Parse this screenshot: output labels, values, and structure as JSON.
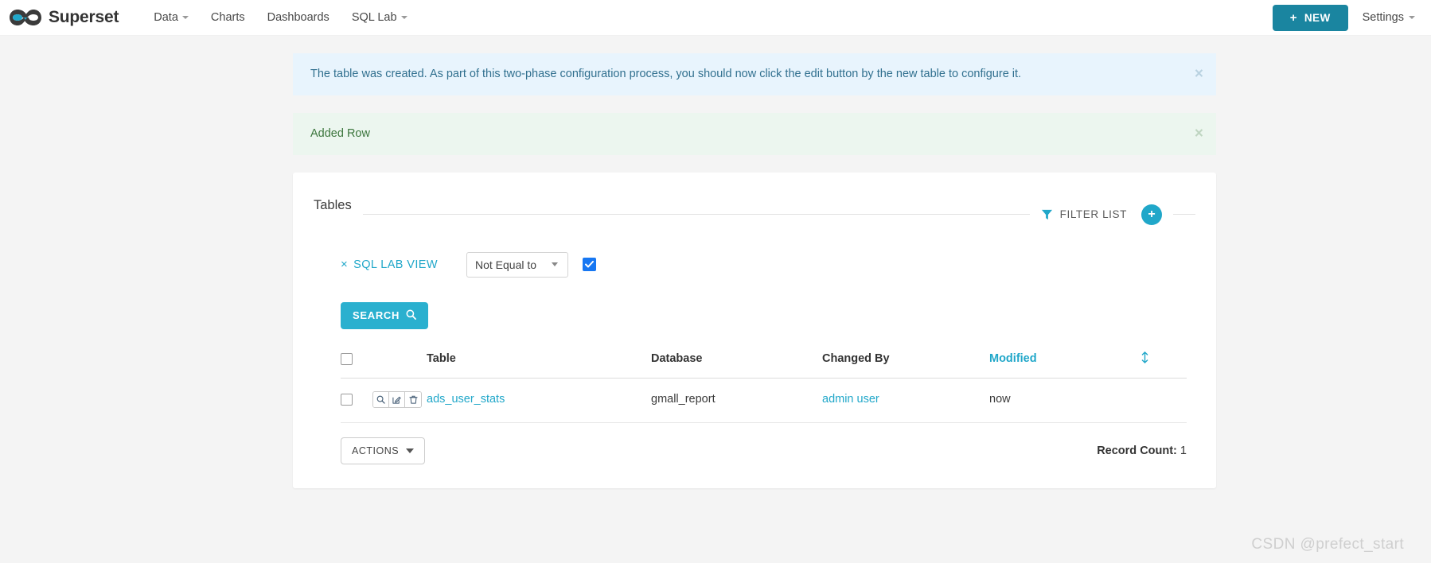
{
  "navbar": {
    "brand": "Superset",
    "brand_logo_icon": "superset-infinity-logo",
    "items": [
      {
        "label": "Data",
        "has_caret": true
      },
      {
        "label": "Charts",
        "has_caret": false
      },
      {
        "label": "Dashboards",
        "has_caret": false
      },
      {
        "label": "SQL Lab",
        "has_caret": true
      }
    ],
    "new_button": {
      "label": "NEW",
      "icon": "plus-icon",
      "color": "#1a85a0"
    },
    "settings": {
      "label": "Settings",
      "has_caret": true
    }
  },
  "alerts": [
    {
      "type": "info",
      "message": "The table was created. As part of this two-phase configuration process, you should now click the edit button by the new table to configure it.",
      "close_label": "×",
      "bg": "#e8f4fd",
      "fg": "#31708f"
    },
    {
      "type": "success",
      "message": "Added Row",
      "close_label": "×",
      "bg": "#ecf6ef",
      "fg": "#3c763d"
    }
  ],
  "panel": {
    "title": "Tables",
    "filter_list_label": "FILTER LIST",
    "filter_icon": "funnel-icon",
    "add_button_label": "+",
    "add_button_icon": "plus-circle-icon",
    "accent_color": "#20a7c9"
  },
  "filters": {
    "chip": {
      "remove_label": "×",
      "label": "SQL LAB VIEW"
    },
    "operator": {
      "value": "Not Equal to",
      "caret_icon": "chevron-down-icon"
    },
    "checkbox": {
      "checked": true,
      "color": "#1777f2",
      "icon": "check-icon"
    },
    "search_button": {
      "label": "SEARCH",
      "icon": "search-icon",
      "color": "#2ab0cf"
    }
  },
  "table": {
    "select_all_checkbox": false,
    "columns": [
      {
        "key": "checkbox",
        "label": ""
      },
      {
        "key": "actions",
        "label": ""
      },
      {
        "key": "table",
        "label": "Table",
        "sortable": false
      },
      {
        "key": "database",
        "label": "Database",
        "sortable": false
      },
      {
        "key": "changed_by",
        "label": "Changed By",
        "sortable": false
      },
      {
        "key": "modified",
        "label": "Modified",
        "sortable": true
      },
      {
        "key": "sort",
        "label": "",
        "icon": "sort-updown-icon"
      }
    ],
    "rows": [
      {
        "selected": false,
        "actions": [
          "search-icon",
          "edit-icon",
          "trash-icon"
        ],
        "table": "ads_user_stats",
        "database": "gmall_report",
        "changed_by": "admin user",
        "modified": "now"
      }
    ],
    "actions_button": {
      "label": "ACTIONS",
      "caret_icon": "chevron-down-icon"
    },
    "record_count_label": "Record Count:",
    "record_count_value": "1"
  },
  "watermark": "CSDN @prefect_start"
}
